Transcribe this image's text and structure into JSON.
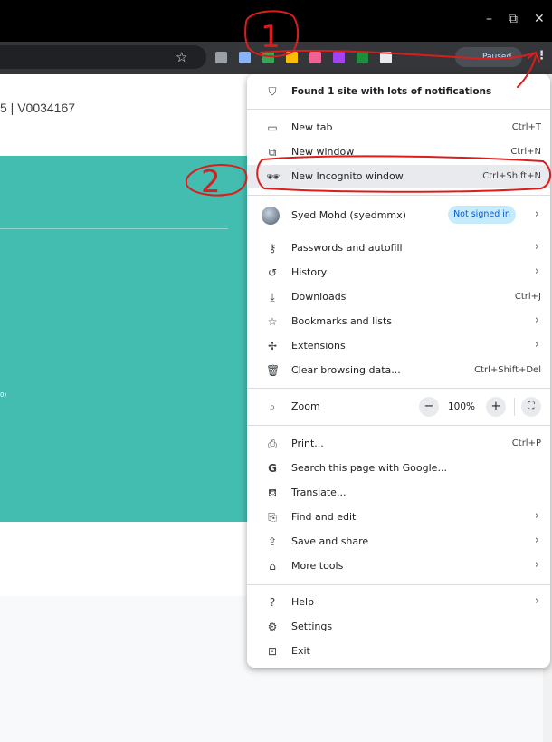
{
  "window": {
    "minimize": "–",
    "restore": "⧉",
    "close": "✕"
  },
  "toolbar": {
    "profile_status": "Paused",
    "extensions": [
      {
        "name": "photo-ext-icon",
        "color": "#9aa0a6"
      },
      {
        "name": "calc-ext-icon",
        "color": "#8ab4f8"
      },
      {
        "name": "chrome-green-ext-icon",
        "color": "#34a853"
      },
      {
        "name": "yellow-ext-icon",
        "color": "#fbbc04"
      },
      {
        "name": "bing-ext-icon",
        "color": "#f06292"
      },
      {
        "name": "purple-ext-icon",
        "color": "#a142f4"
      },
      {
        "name": "green-ext-icon",
        "color": "#1e8e3e"
      },
      {
        "name": "puzzle-ext-icon",
        "color": "#e8eaed"
      }
    ]
  },
  "page": {
    "id_text": "5 | V0034167",
    "tiny_text": "0)"
  },
  "menu": {
    "notifications": "Found 1 site with lots of notifications",
    "new_tab": {
      "label": "New tab",
      "shortcut": "Ctrl+T"
    },
    "new_window": {
      "label": "New window",
      "shortcut": "Ctrl+N"
    },
    "new_incognito": {
      "label": "New Incognito window",
      "shortcut": "Ctrl+Shift+N"
    },
    "profile": {
      "name": "Syed Mohd (syedmmx)",
      "status": "Not signed in"
    },
    "passwords": {
      "label": "Passwords and autofill"
    },
    "history": {
      "label": "History"
    },
    "downloads": {
      "label": "Downloads",
      "shortcut": "Ctrl+J"
    },
    "bookmarks": {
      "label": "Bookmarks and lists"
    },
    "extensions": {
      "label": "Extensions"
    },
    "clear": {
      "label": "Clear browsing data...",
      "shortcut": "Ctrl+Shift+Del"
    },
    "zoom": {
      "label": "Zoom",
      "value": "100%",
      "minus": "−",
      "plus": "+"
    },
    "print": {
      "label": "Print...",
      "shortcut": "Ctrl+P"
    },
    "search_google": {
      "label": "Search this page with Google..."
    },
    "translate": {
      "label": "Translate..."
    },
    "find_edit": {
      "label": "Find and edit"
    },
    "save_share": {
      "label": "Save and share"
    },
    "more_tools": {
      "label": "More tools"
    },
    "help": {
      "label": "Help"
    },
    "settings": {
      "label": "Settings"
    },
    "exit": {
      "label": "Exit"
    }
  },
  "annotations": {
    "step1": "1",
    "step2": "2",
    "color": "#d81e1e"
  }
}
